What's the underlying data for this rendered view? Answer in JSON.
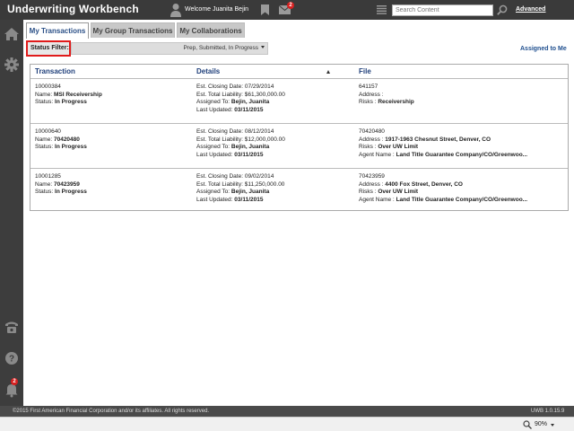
{
  "header": {
    "app_title": "Underwriting Workbench",
    "welcome": "Welcome Juanita Bejin",
    "mail_count": "2",
    "search_placeholder": "Search Content",
    "advanced_label": "Advanced"
  },
  "sidebar": {
    "items": [
      {
        "icon": "home-icon"
      },
      {
        "icon": "gear-icon"
      },
      {
        "icon": "phone-icon"
      },
      {
        "icon": "help-icon"
      },
      {
        "icon": "bell-icon"
      }
    ],
    "notification_count": "2"
  },
  "tabs": [
    {
      "label": "My Transactions",
      "active": true
    },
    {
      "label": "My Group Transactions",
      "active": false
    },
    {
      "label": "My Collaborations",
      "active": false
    }
  ],
  "filter": {
    "label": "Status Filter:",
    "value": "Prep, Submitted, In Progress"
  },
  "assigned_link": "Assigned to Me",
  "table": {
    "columns": [
      "Transaction",
      "Details",
      "File"
    ],
    "rows": [
      {
        "number": "10000384",
        "name_label": "Name:",
        "name": "MSI Receivership",
        "status_label": "Status:",
        "status": "In Progress",
        "closing_label": "Est. Closing Date:",
        "closing": "07/29/2014",
        "liability_label": "Est. Total Liability:",
        "liability": "$61,300,000.00",
        "assigned_label": "Assigned To:",
        "assigned": "Bejin, Juanita",
        "updated_label": "Last Updated:",
        "updated": "03/11/2015",
        "file_number": "641157",
        "address_label": "Address :",
        "address": "",
        "risks_label": "Risks :",
        "risks": "Receivership",
        "agent_label": "",
        "agent": ""
      },
      {
        "number": "10000640",
        "name_label": "Name:",
        "name": "70420480",
        "status_label": "Status:",
        "status": "In Progress",
        "closing_label": "Est. Closing Date:",
        "closing": "08/12/2014",
        "liability_label": "Est. Total Liability:",
        "liability": "$12,000,000.00",
        "assigned_label": "Assigned To:",
        "assigned": "Bejin, Juanita",
        "updated_label": "Last Updated:",
        "updated": "03/11/2015",
        "file_number": "70420480",
        "address_label": "Address :",
        "address": "1917-1963 Chesnut Street, Denver, CO",
        "risks_label": "Risks :",
        "risks": "Over UW Limit",
        "agent_label": "Agent Name :",
        "agent": "Land Title Guarantee Company/CO/Greenwoo..."
      },
      {
        "number": "10001285",
        "name_label": "Name:",
        "name": "70423959",
        "status_label": "Status:",
        "status": "In Progress",
        "closing_label": "Est. Closing Date:",
        "closing": "09/02/2014",
        "liability_label": "Est. Total Liability:",
        "liability": "$11,250,000.00",
        "assigned_label": "Assigned To:",
        "assigned": "Bejin, Juanita",
        "updated_label": "Last Updated:",
        "updated": "03/11/2015",
        "file_number": "70423959",
        "address_label": "Address :",
        "address": "4400 Fox Street, Denver, CO",
        "risks_label": "Risks :",
        "risks": "Over UW Limit",
        "agent_label": "Agent Name :",
        "agent": "Land Title Guarantee Company/CO/Greenwoo..."
      }
    ]
  },
  "footer": {
    "copyright": "©2015 First American Financial Corporation and/or its affiliates. All rights reserved.",
    "version": "UWB 1.0.15.9"
  },
  "statusbar": {
    "zoom": "90%"
  },
  "colors": {
    "header_bg": "#3a3a3a",
    "accent_blue": "#1f3f7a",
    "highlight_red": "#e01b1b"
  }
}
